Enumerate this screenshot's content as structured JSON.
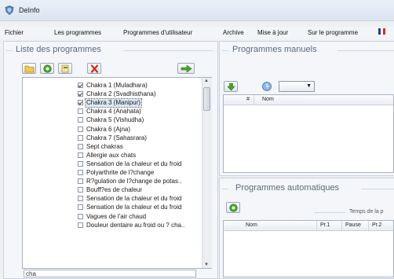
{
  "window": {
    "title": "DeInfo"
  },
  "menu": {
    "items": [
      "Fichier",
      "Les programmes",
      "Programmes d'utilisateur",
      "Archive",
      "Mise à jour",
      "Sur le programme"
    ]
  },
  "left_panel": {
    "title": "Liste des programmes",
    "toolbar": [
      "folder-icon",
      "add-icon",
      "copy-icon",
      "delete-icon",
      "arrow-right-icon"
    ],
    "items": [
      {
        "label": "Chakra 1 (Muladhara)",
        "checked": true
      },
      {
        "label": "Chakra 2 (Svadhisthana)",
        "checked": true
      },
      {
        "label": "Chakra 3 (Manipur)",
        "checked": true,
        "selected": true
      },
      {
        "label": "Chakra 4 (Anahata)",
        "checked": false
      },
      {
        "label": "Chakra 5 (Vishudha)",
        "checked": false
      },
      {
        "label": "Chakra 6 (Ajna)",
        "checked": false
      },
      {
        "label": "Chakra 7 (Sahasrara)",
        "checked": false
      },
      {
        "label": "Sept chakras",
        "checked": false
      },
      {
        "label": "Allergie aux chats",
        "checked": false
      },
      {
        "label": "Sensation de la chaleur et du froid",
        "checked": false
      },
      {
        "label": "Polyarthrite de l?change",
        "checked": false
      },
      {
        "label": "R?gulation de l?change de potas..",
        "checked": false
      },
      {
        "label": "Bouff?es de chaleur",
        "checked": false
      },
      {
        "label": "Sensation de la chaleur et du froid",
        "checked": false
      },
      {
        "label": "Sensation de la chaleur et du froid",
        "checked": false
      },
      {
        "label": "Vagues de l'air chaud",
        "checked": false
      },
      {
        "label": "Douleur dentaire au froid ou ? cha..",
        "checked": false
      }
    ],
    "search_value": "cha"
  },
  "manual_panel": {
    "title": "Programmes manuels",
    "columns": [
      "#",
      "Nom"
    ]
  },
  "auto_panel": {
    "title": "Programmes automatiques",
    "caption": "Temps de la p",
    "columns": [
      "Nom",
      "Pr.1",
      "Pause",
      "Pr.2"
    ]
  },
  "colors": {
    "accent_green": "#4aa32c",
    "delete_red": "#d12b1f",
    "selection": "#dbe8f6"
  }
}
